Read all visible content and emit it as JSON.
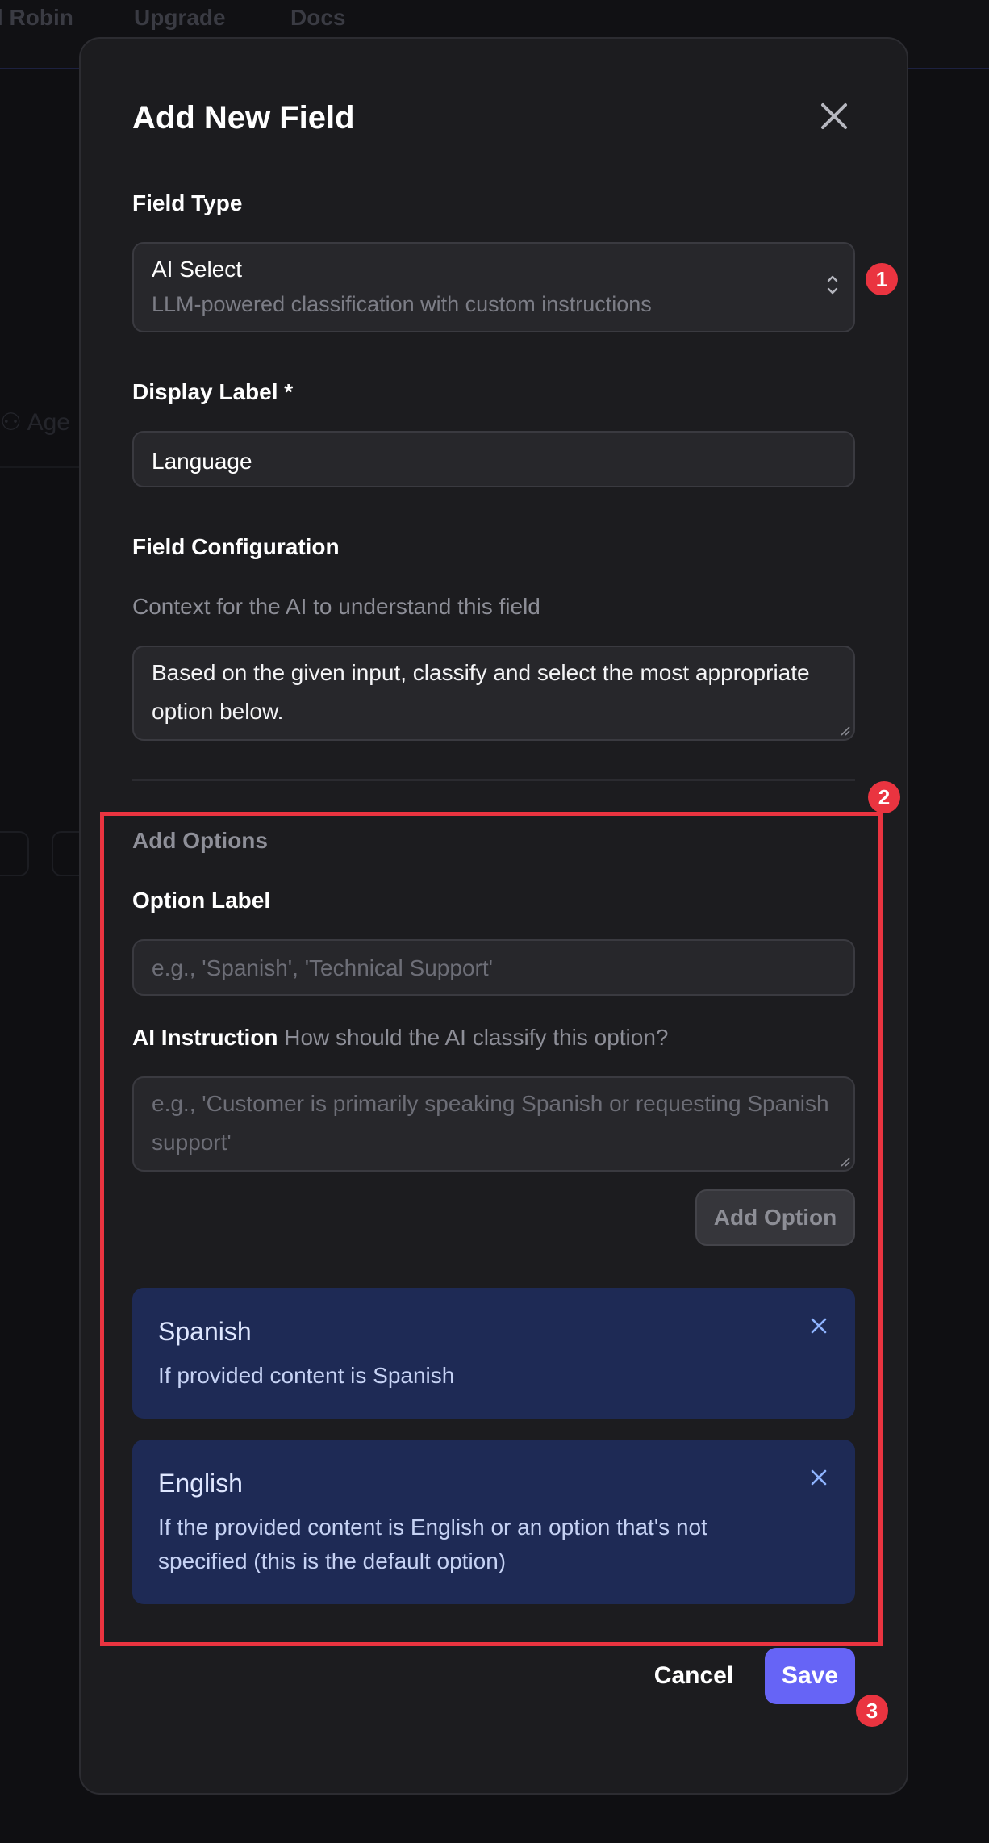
{
  "background": {
    "nav": [
      "l Robin",
      "Upgrade",
      "Docs"
    ],
    "faint_text": "Age"
  },
  "modal": {
    "title": "Add New Field",
    "field_type": {
      "label": "Field Type",
      "value": "AI Select",
      "description": "LLM-powered classification with custom instructions"
    },
    "display_label": {
      "label": "Display Label *",
      "value": "Language"
    },
    "configuration": {
      "label": "Field Configuration",
      "hint": "Context for the AI to understand this field",
      "value": "Based on the given input, classify and select the most appropriate option below."
    },
    "options_section": {
      "title": "Add Options",
      "option_label": {
        "label": "Option Label",
        "placeholder": "e.g., 'Spanish', 'Technical Support'"
      },
      "ai_instruction": {
        "label": "AI Instruction",
        "hint": "How should the AI classify this option?",
        "placeholder": "e.g., 'Customer is primarily speaking Spanish or requesting Spanish support'"
      },
      "add_button": "Add Option",
      "options": [
        {
          "name": "Spanish",
          "instruction": "If provided content is Spanish"
        },
        {
          "name": "English",
          "instruction": "If the provided content is English or an option that's not specified (this is the default option)"
        }
      ]
    },
    "cancel_label": "Cancel",
    "save_label": "Save"
  },
  "annotations": {
    "badge1": "1",
    "badge2": "2",
    "badge3": "3"
  },
  "colors": {
    "accent": "#6664f6",
    "option_card": "#1e2a55",
    "annotation": "#ea3440",
    "modal_bg": "#1c1c1f"
  }
}
